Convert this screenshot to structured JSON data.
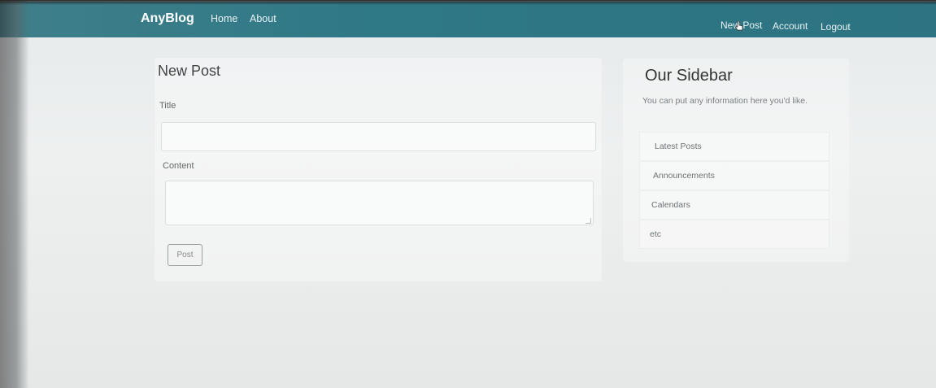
{
  "navbar": {
    "brand": "AnyBlog",
    "left_links": [
      "Home",
      "About"
    ],
    "right_links": [
      "New Post",
      "Account",
      "Logout"
    ]
  },
  "form": {
    "title": "New Post",
    "title_label": "Title",
    "title_value": "",
    "content_label": "Content",
    "content_value": "",
    "submit_label": "Post"
  },
  "sidebar": {
    "title": "Our Sidebar",
    "description": "You can put any information here you'd like.",
    "items": [
      "Latest Posts",
      "Announcements",
      "Calendars",
      "etc"
    ]
  }
}
